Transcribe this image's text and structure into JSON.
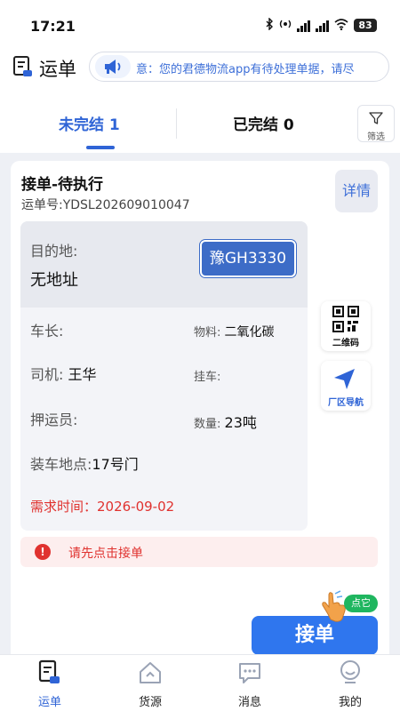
{
  "status_bar": {
    "time": "17:21",
    "network": "5G",
    "battery": "83"
  },
  "header": {
    "title": "运单",
    "notice_text": "意：您的君德物流app有待处理单据，请尽"
  },
  "tabs": {
    "unfinished_label": "未完结 1",
    "finished_label": "已完结 0",
    "filter_label": "筛选"
  },
  "order": {
    "status_title": "接单-待执行",
    "order_no": "运单号:YDSL202609010047",
    "detail_label": "详情",
    "destination_label": "目的地:",
    "destination_value": "无地址",
    "plate": "豫GH3330",
    "vehicle_length_label": "车长:",
    "material_label": "物料:",
    "material_value": "二氧化碳",
    "driver_label": "司机:",
    "driver_value": "王华",
    "trailer_label": "挂车:",
    "escort_label": "押运员:",
    "quantity_label": "数量:",
    "quantity_value": "23吨",
    "loading_label": "装车地点:",
    "loading_value": "17号门",
    "demand_time": "需求时间：2026-09-02",
    "qrcode_label": "二维码",
    "navigation_label": "厂区导航",
    "warning": "请先点击接单",
    "warning_icon": "!",
    "accept_label": "接单",
    "tip_label": "点它"
  },
  "bottom_nav": {
    "waybill": "运单",
    "cargo": "货源",
    "messages": "消息",
    "mine": "我的"
  },
  "colors": {
    "primary": "#2f64d6",
    "danger": "#e0322f",
    "plate": "#3d6cc7",
    "tip": "#1fb65f"
  }
}
